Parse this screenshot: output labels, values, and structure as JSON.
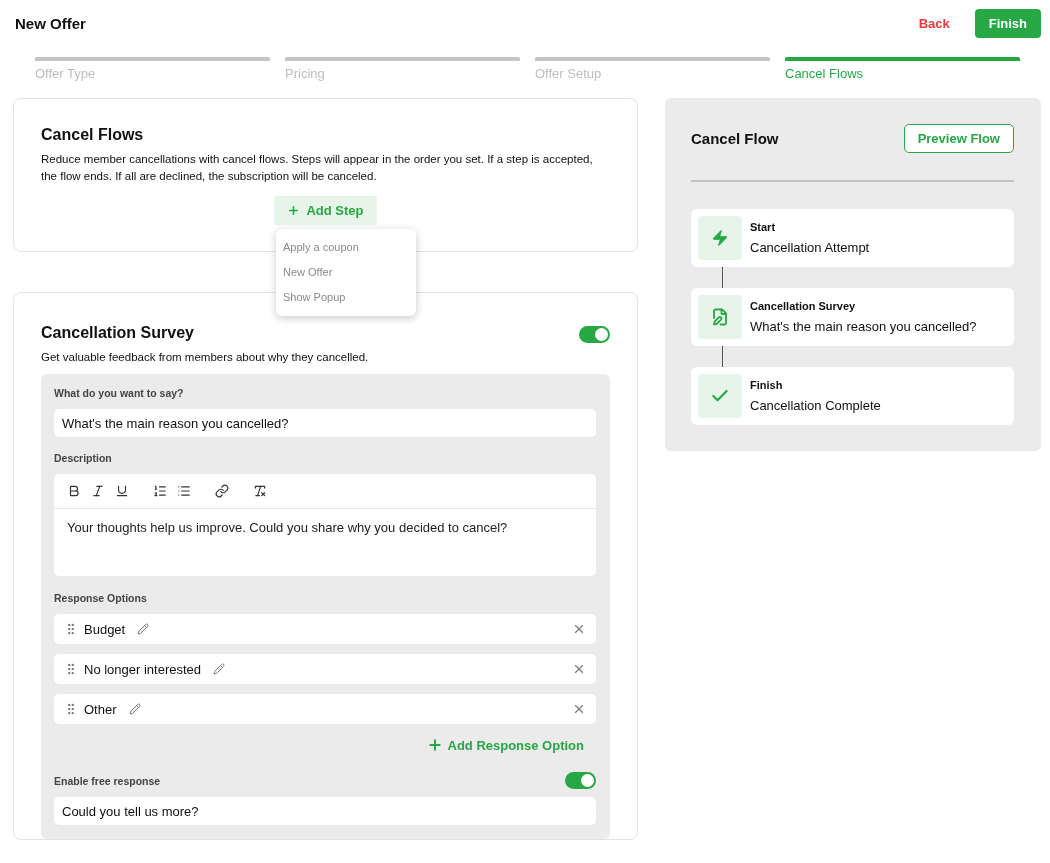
{
  "header": {
    "title": "New Offer",
    "back": "Back",
    "finish": "Finish"
  },
  "steps": [
    {
      "label": "Offer Type",
      "selected": false
    },
    {
      "label": "Pricing",
      "selected": false
    },
    {
      "label": "Offer Setup",
      "selected": false
    },
    {
      "label": "Cancel Flows",
      "selected": true
    }
  ],
  "cancel_flows": {
    "title": "Cancel Flows",
    "description": "Reduce member cancellations with cancel flows. Steps will appear in the order you set. If a step is accepted, the flow ends. If all are declined, the subscription will be canceled.",
    "add_step": "Add Step",
    "menu": [
      "Apply a coupon",
      "New Offer",
      "Show Popup"
    ]
  },
  "survey": {
    "title": "Cancellation Survey",
    "on": true,
    "description": "Get valuable feedback from members about why they cancelled.",
    "question_label": "What do you want to say?",
    "question": "What's the main reason you cancelled?",
    "description_label": "Description",
    "description_text": "Your thoughts help us improve. Could you share why you decided to cancel?",
    "options_label": "Response Options",
    "options": [
      "Budget",
      "No longer interested",
      "Other"
    ],
    "add_option": "Add Response Option",
    "free_response_label": "Enable free response",
    "free_response_on": true,
    "free_response": "Could you tell us more?"
  },
  "flow": {
    "title": "Cancel Flow",
    "preview": "Preview Flow",
    "items": [
      {
        "kind": "start",
        "title": "Start",
        "text": "Cancellation Attempt"
      },
      {
        "kind": "survey",
        "title": "Cancellation Survey",
        "text": "What's the main reason you cancelled?"
      },
      {
        "kind": "finish",
        "title": "Finish",
        "text": "Cancellation Complete"
      }
    ]
  }
}
